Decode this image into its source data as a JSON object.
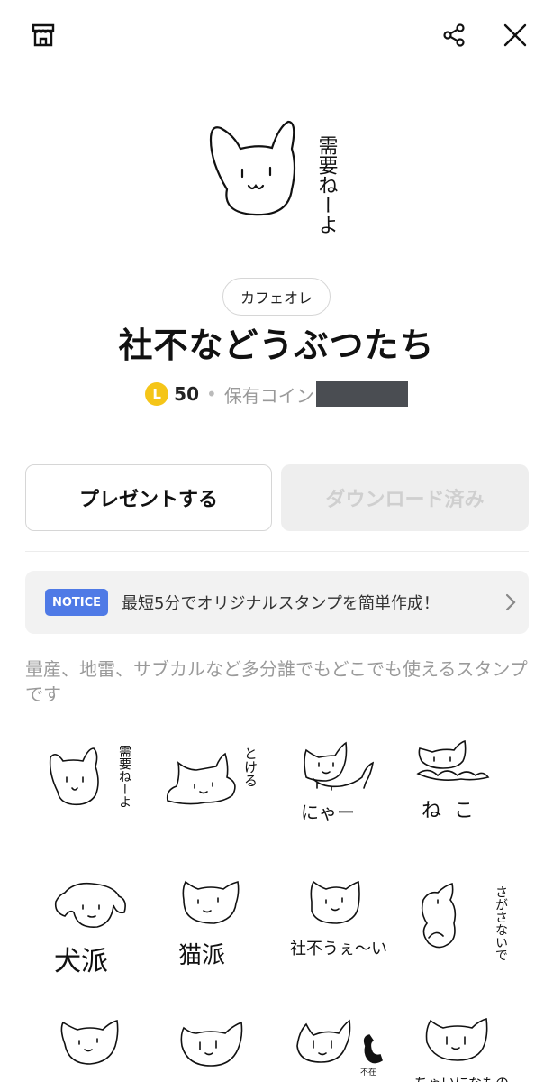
{
  "header": {
    "shop_icon": "shop-icon",
    "share_icon": "share-icon",
    "close_icon": "close-icon"
  },
  "hero_sticker": {
    "text": "需要ねーよ"
  },
  "author": "カフェオレ",
  "title": "社不などうぶつたち",
  "price": {
    "coin_symbol": "L",
    "amount": "50",
    "separator": "•",
    "owned_label": "保有コイン"
  },
  "buttons": {
    "present": "プレゼントする",
    "download": "ダウンロード済み"
  },
  "notice": {
    "badge": "NOTICE",
    "text": "最短5分でオリジナルスタンプを簡単作成！"
  },
  "description": "量産、地雷、サブカルなど多分誰でもどこでも使えるスタンプです",
  "stickers": [
    {
      "text": "需要ねーよ"
    },
    {
      "text": "とける"
    },
    {
      "text": "にゃー"
    },
    {
      "text": "ねこ"
    },
    {
      "text": "犬派"
    },
    {
      "text": "猫派"
    },
    {
      "text": "社不うぇ～い"
    },
    {
      "text": "さがさないで"
    },
    {
      "text": ""
    },
    {
      "text": ""
    },
    {
      "text": "不在"
    },
    {
      "text": "ちゃいになもの"
    }
  ],
  "colors": {
    "notice_badge": "#4f7ae6",
    "coin": "#f5c518",
    "disabled_button_bg": "#eeeeee",
    "redaction": "#4a4d52"
  }
}
